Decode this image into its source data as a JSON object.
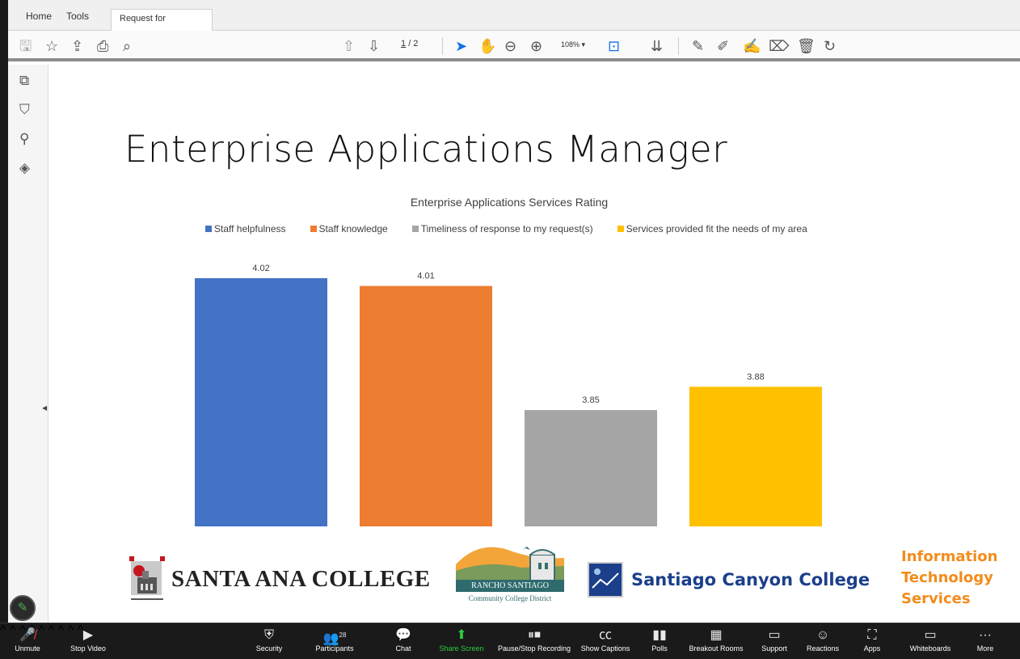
{
  "tabs": {
    "home": "Home",
    "tools": "Tools",
    "doc": "Request for resourc...",
    "close": "×"
  },
  "toolbar": {
    "save_icon": "floppy-icon",
    "page_current": "1",
    "page_total": "/ 2",
    "zoom": "108%"
  },
  "slide": {
    "title": "Enterprise Applications Manager"
  },
  "chart_data": {
    "type": "bar",
    "title": "Enterprise Applications Services Rating",
    "series": [
      {
        "name": "Staff helpfulness",
        "value": 4.02,
        "color": "#4472c4",
        "label": "4.02"
      },
      {
        "name": "Staff knowledge",
        "value": 4.01,
        "color": "#ed7d31",
        "label": "4.01"
      },
      {
        "name": "Timeliness of response to my request(s)",
        "value": 3.85,
        "color": "#a5a5a5",
        "label": "3.85"
      },
      {
        "name": "Services provided fit the needs of my area",
        "value": 3.88,
        "color": "#ffc000",
        "label": "3.88"
      }
    ],
    "legend_position": "top"
  },
  "logos": {
    "sac": "SANTA ANA COLLEGE",
    "rs_line1": "RANCHO SANTIAGO",
    "rs_line2": "Community College District",
    "scc": "Santiago Canyon College",
    "its_1": "Information",
    "its_2": "Technology",
    "its_3": "Services"
  },
  "zoom_bar": {
    "unmute": "Unmute",
    "stop_video": "Stop Video",
    "security": "Security",
    "participants": "Participants",
    "participants_count": "28",
    "chat": "Chat",
    "share_screen": "Share Screen",
    "record": "Pause/Stop Recording",
    "captions": "Show Captions",
    "polls": "Polls",
    "breakout": "Breakout Rooms",
    "support": "Support",
    "reactions": "Reactions",
    "apps": "Apps",
    "whiteboards": "Whiteboards",
    "more": "More"
  }
}
